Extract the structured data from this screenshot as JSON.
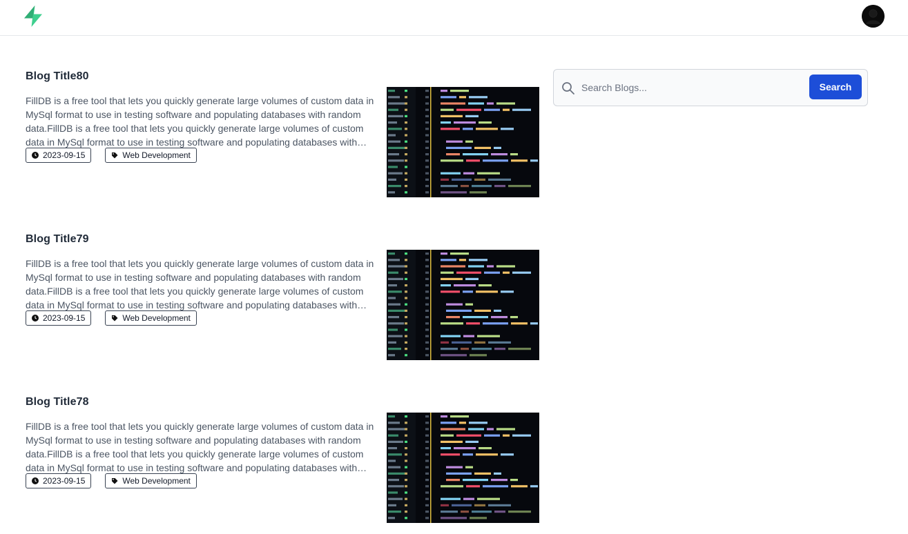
{
  "header": {
    "logo_icon": "supabase-bolt-logo-icon",
    "avatar_icon": "user-avatar-icon"
  },
  "posts": [
    {
      "title": "Blog Title80",
      "excerpt": "FillDB is a free tool that lets you quickly generate large volumes of custom data in MySql format to use in testing software and populating databases with random data.FillDB is a free tool that lets you quickly generate large volumes of custom data in MySql format to use in testing software and populating databases with random data.",
      "date": "2023-09-15",
      "tag": "Web Development"
    },
    {
      "title": "Blog Title79",
      "excerpt": "FillDB is a free tool that lets you quickly generate large volumes of custom data in MySql format to use in testing software and populating databases with random data.FillDB is a free tool that lets you quickly generate large volumes of custom data in MySql format to use in testing software and populating databases with random data.",
      "date": "2023-09-15",
      "tag": "Web Development"
    },
    {
      "title": "Blog Title78",
      "excerpt": "FillDB is a free tool that lets you quickly generate large volumes of custom data in MySql format to use in testing software and populating databases with random data.FillDB is a free tool that lets you quickly generate large volumes of custom data in MySql format to use in testing software and populating databases with random data.",
      "date": "2023-09-15",
      "tag": "Web Development"
    }
  ],
  "search": {
    "placeholder": "Search Blogs...",
    "value": "",
    "button_label": "Search"
  },
  "colors": {
    "brand_green": "#3ecf8e",
    "button_blue": "#1d4ed8"
  }
}
